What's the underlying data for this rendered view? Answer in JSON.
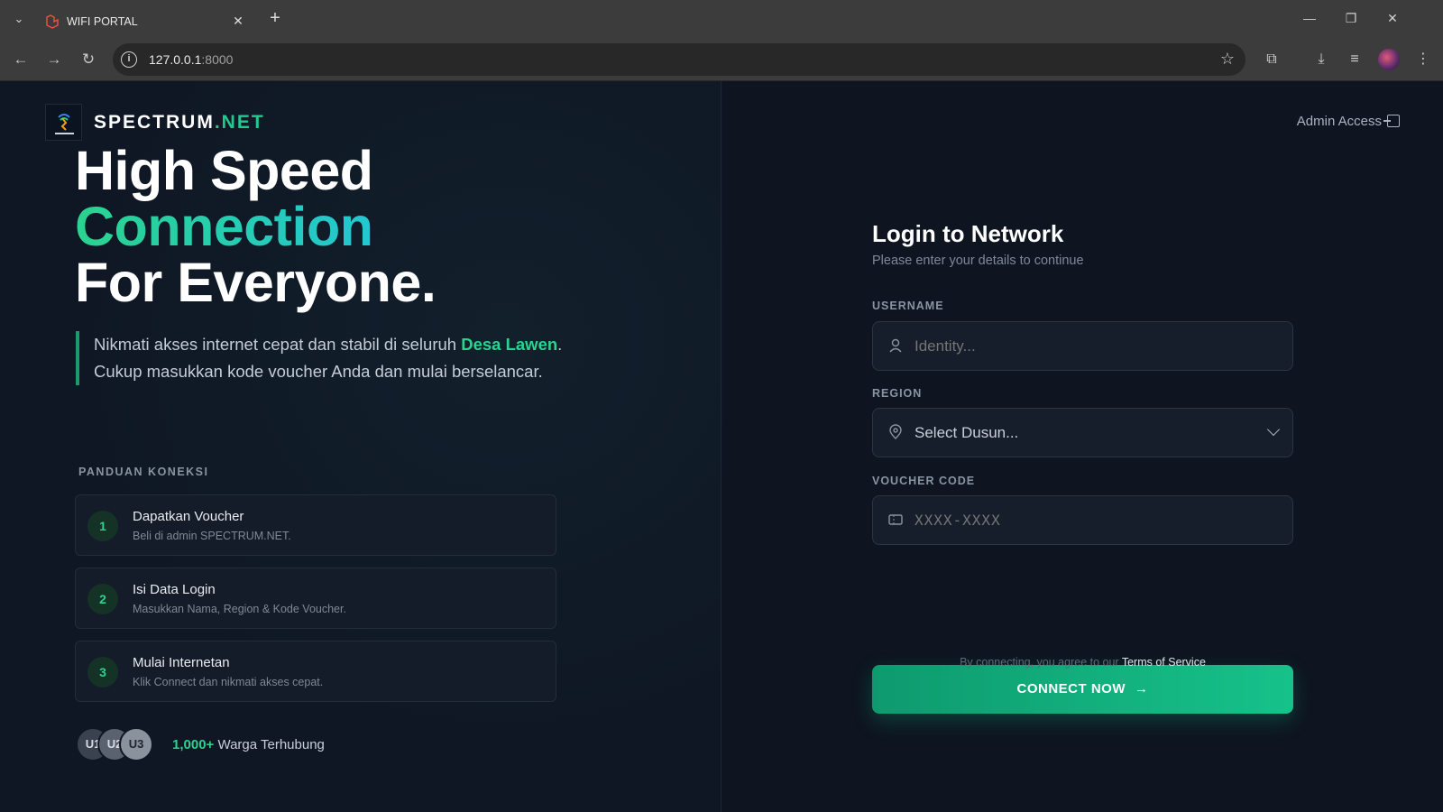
{
  "browser": {
    "tab_title": "WIFI PORTAL",
    "url_host": "127.0.0.1",
    "url_port": ":8000"
  },
  "brand": {
    "name_main": "SPECTRUM",
    "name_accent": ".NET"
  },
  "hero": {
    "line1": "High Speed",
    "line2": "Connection",
    "line3": "For Everyone."
  },
  "description": {
    "part1": "Nikmati akses internet cepat dan stabil di seluruh ",
    "highlight": "Desa Lawen",
    "part2": ". Cukup masukkan kode voucher Anda dan mulai berselancar."
  },
  "guide": {
    "title": "PANDUAN KONEKSI",
    "steps": [
      {
        "num": "1",
        "title": "Dapatkan Voucher",
        "sub": "Beli di admin SPECTRUM.NET."
      },
      {
        "num": "2",
        "title": "Isi Data Login",
        "sub": "Masukkan Nama, Region & Kode Voucher."
      },
      {
        "num": "3",
        "title": "Mulai Internetan",
        "sub": "Klik Connect dan nikmati akses cepat."
      }
    ]
  },
  "community": {
    "avatars": [
      "U1",
      "U2",
      "U3"
    ],
    "count": "1,000+",
    "label": " Warga Terhubung"
  },
  "admin_access": "Admin Access",
  "form": {
    "title": "Login to Network",
    "subtitle": "Please enter your details to continue",
    "username_label": "USERNAME",
    "username_placeholder": "Identity...",
    "region_label": "REGION",
    "region_value": "Select Dusun...",
    "voucher_label": "VOUCHER CODE",
    "voucher_placeholder": "XXXX-XXXX",
    "connect_label": "CONNECT NOW",
    "terms_text": "By connecting, you agree to our ",
    "terms_link": "Terms of Service"
  },
  "colors": {
    "accent": "#2ad38e",
    "background": "#0f1622",
    "button": "#10b981"
  }
}
